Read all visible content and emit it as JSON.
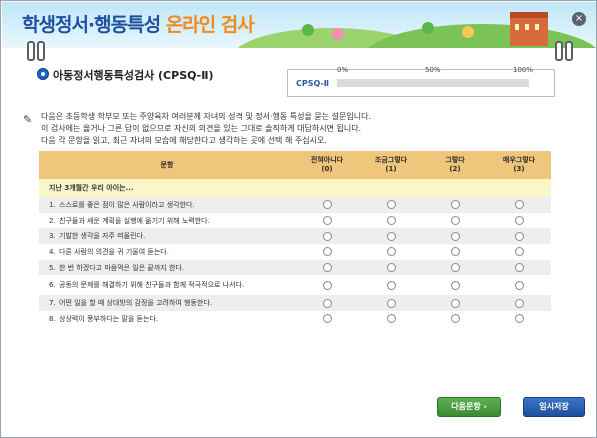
{
  "header": {
    "title_main": "학생정서·행동특성 ",
    "title_accent": "온라인 검사",
    "close_label": "×"
  },
  "section": {
    "title": "아동정서행동특성검사 (CPSQ-Ⅱ)"
  },
  "progress": {
    "label": "CPSQ-Ⅱ",
    "ticks": [
      "0%",
      "50%",
      "100%"
    ],
    "value_percent": 0
  },
  "instructions": [
    "다음은 초등학생 학부모 또는 주양육자 여러분께 자녀의 성격 및 정서·행동 특성을 묻는 설문입니다.",
    "이 검사에는 옳거나 그른 답이 없으므로 자신의 의견을 있는 그대로 솔직하게 대답하시면 됩니다.",
    "다음 각 문항을 읽고, 최근 자녀의 모습에 해당한다고 생각하는 곳에 선택 해 주십시오."
  ],
  "table": {
    "headers": {
      "question": "문항",
      "opt0": "전혀아니다",
      "opt0_val": "(0)",
      "opt1": "조금그렇다",
      "opt1_val": "(1)",
      "opt2": "그렇다",
      "opt2_val": "(2)",
      "opt3": "매우그렇다",
      "opt3_val": "(3)"
    },
    "group_label": "지난 3개월간 우리 아이는...",
    "questions": [
      {
        "num": "1.",
        "text": "스스로를 좋은 점이 많은 사람이라고 생각한다."
      },
      {
        "num": "2.",
        "text": "친구들과 세운 계획을 실행에 옮기기 위해 노력한다."
      },
      {
        "num": "3.",
        "text": "기발한 생각을 자주 떠올린다."
      },
      {
        "num": "4.",
        "text": "다른 사람의 의견을 귀 기울여 듣는다."
      },
      {
        "num": "5.",
        "text": "한 번 하겠다고 마음먹은 일은 끝까지 한다."
      },
      {
        "num": "6.",
        "text": "공동의 문제를 해결하기 위해 친구들과 함께 적극적으로 나서다."
      },
      {
        "num": "7.",
        "text": "어떤 일을 할 때 상대방의 감정을 고려하여 행동한다."
      },
      {
        "num": "8.",
        "text": "상상력이 풍부하다는 말을 듣는다."
      }
    ]
  },
  "buttons": {
    "next": "다음문항 ›",
    "save": "임시저장"
  },
  "colors": {
    "header_bg": "#bfe6f7",
    "title": "#1f4fa0",
    "title_accent": "#f08a1c",
    "table_header": "#efc67b",
    "group_row": "#fbf6c7",
    "next_button": "#4a9c40",
    "save_button": "#2a5fb0"
  }
}
